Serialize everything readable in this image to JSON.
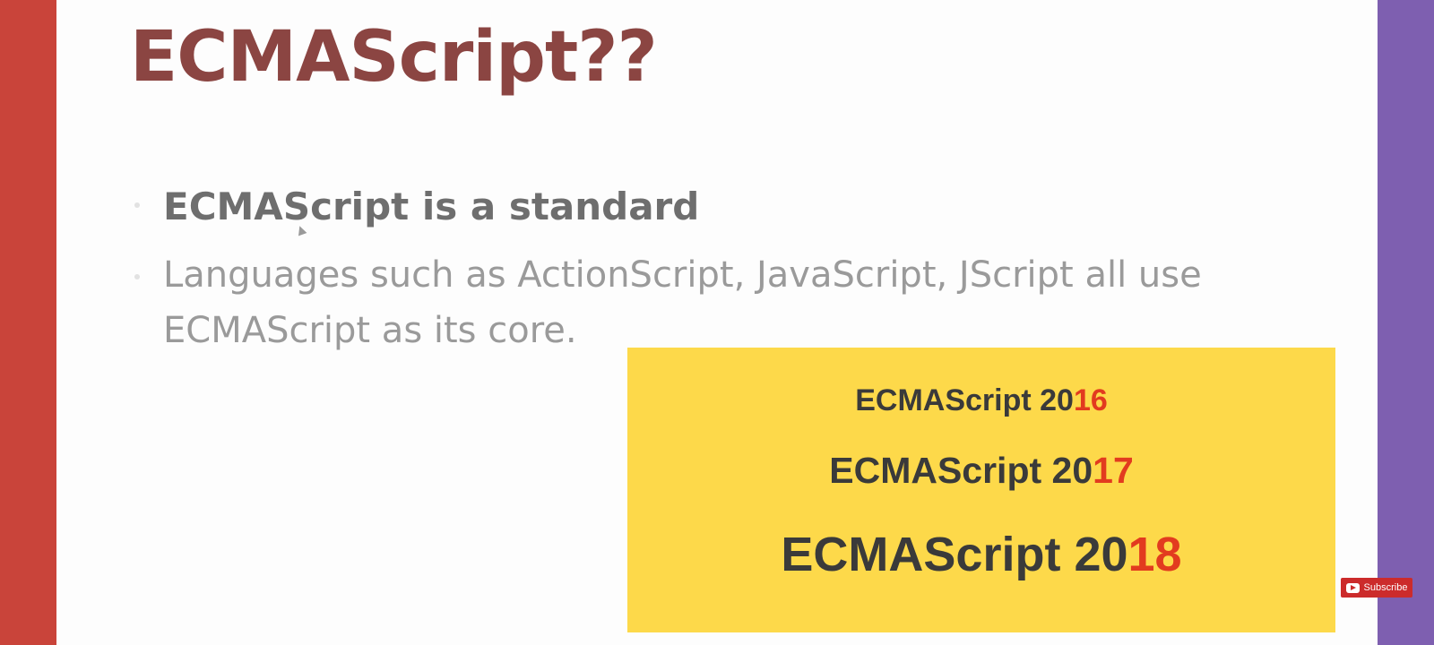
{
  "colors": {
    "left_bar": "#c9443a",
    "right_bar": "#7e5fb0",
    "slide_bg": "#fdfdfd",
    "title": "#8b4542",
    "bullet_primary": "#6e6e6e",
    "bullet_secondary": "#9a9a9a",
    "yellow_box": "#fdd94a",
    "version_text": "#3a3a3a",
    "version_accent": "#e23b1f",
    "subscribe_bg": "#cc2b2b"
  },
  "slide": {
    "title": "ECMAScript??",
    "bullets": [
      "ECMAScript is a standard",
      " Languages such as ActionScript, JavaScript, JScript all use ECMAScript as its core."
    ]
  },
  "versions_box": {
    "items": [
      {
        "prefix": "ECMAScript 20",
        "suffix": "16"
      },
      {
        "prefix": "ECMAScript 20",
        "suffix": "17"
      },
      {
        "prefix": "ECMAScript 20",
        "suffix": "18"
      }
    ]
  },
  "player": {
    "subscribe_label": "Subscribe",
    "subscribe_icon": "youtube-play-icon"
  }
}
